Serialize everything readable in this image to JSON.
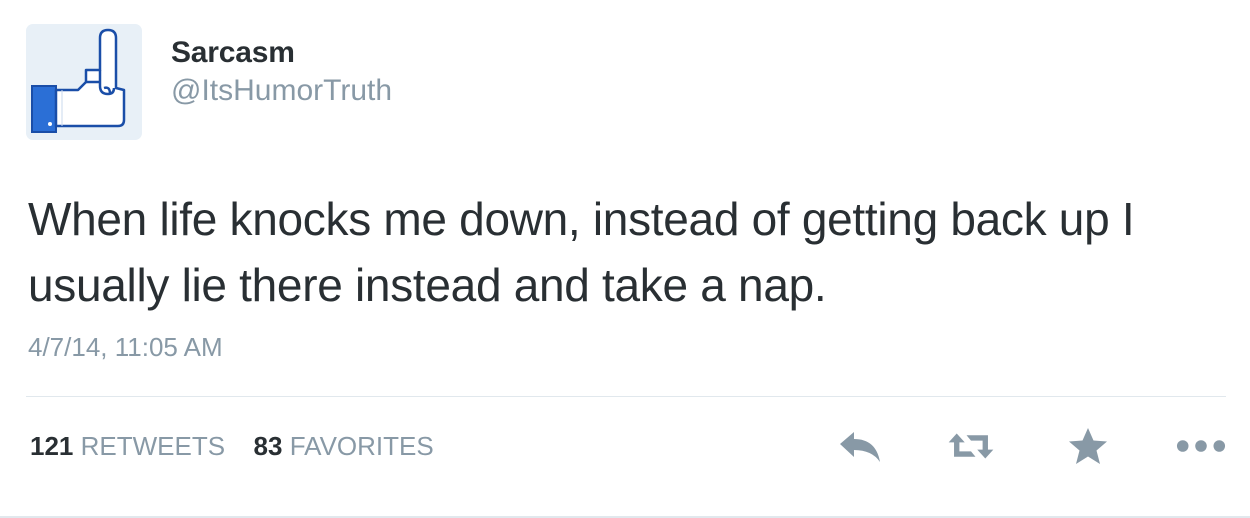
{
  "user": {
    "display_name": "Sarcasm",
    "handle": "@ItsHumorTruth",
    "avatar_icon": "middle-finger-like-icon"
  },
  "tweet": {
    "text": "When life knocks me down, instead of getting back up I usually lie there instead and take a nap.",
    "timestamp": "4/7/14, 11:05 AM"
  },
  "stats": {
    "retweets_count": "121",
    "retweets_label": "RETWEETS",
    "favorites_count": "83",
    "favorites_label": "FAVORITES"
  },
  "actions": [
    {
      "name": "reply",
      "icon": "reply-icon"
    },
    {
      "name": "retweet",
      "icon": "retweet-icon"
    },
    {
      "name": "favorite",
      "icon": "star-icon"
    },
    {
      "name": "more",
      "icon": "more-icon"
    }
  ],
  "colors": {
    "text": "#292f33",
    "secondary": "#8899a6",
    "divider": "#e1e8ed",
    "avatar_blue": "#2b6fd6"
  }
}
